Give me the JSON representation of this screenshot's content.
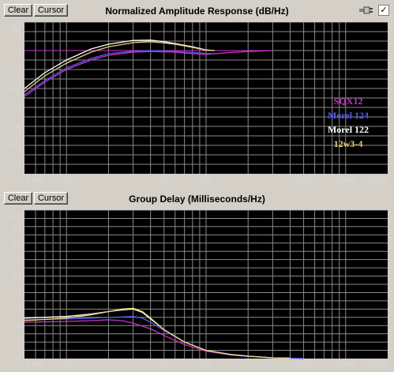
{
  "top": {
    "clear_label": "Clear",
    "cursor_label": "Cursor",
    "title": "Normalized Amplitude Response (dB/Hz)",
    "check": "✓"
  },
  "bottom": {
    "clear_label": "Clear",
    "cursor_label": "Cursor",
    "title": "Group Delay (Milliseconds/Hz)"
  },
  "colors": {
    "plot_bg": "#000000",
    "grid": "#8a8a8a",
    "tick_text": "#d8d8d8",
    "zero_line": "#cc33cc"
  },
  "chart_data": [
    {
      "type": "line",
      "title": "Normalized Amplitude Response (dB/Hz)",
      "x_scale": "log",
      "xlim": [
        5,
        2000
      ],
      "ylim": [
        -39,
        9
      ],
      "y_unit_label": "dB",
      "x_ticks": [
        5,
        10,
        50,
        100,
        500,
        1000,
        2000
      ],
      "x_tick_labels": [
        "5 Hz",
        "10",
        "50",
        "100",
        "500",
        "1000",
        "2000"
      ],
      "y_ticks": [
        6,
        0,
        -6,
        -12,
        -18,
        -24,
        -30,
        -36
      ],
      "y_tick_labels": [
        "6",
        "0",
        "-6",
        "-12",
        "-18",
        "-24",
        "-30",
        "-36"
      ],
      "grid": true,
      "legend_placement": "right",
      "series": [
        {
          "name": "SQX12",
          "color": "#cc33cc",
          "x": [
            5,
            7,
            10,
            15,
            20,
            30,
            40,
            60,
            80,
            100,
            150,
            200,
            300
          ],
          "y": [
            -14.5,
            -10,
            -6,
            -3,
            -1.5,
            -0.5,
            -0.3,
            -0.5,
            -1.0,
            -1.2,
            -0.6,
            -0.3,
            0
          ]
        },
        {
          "name": "Morel 124",
          "color": "#5555ee",
          "x": [
            5,
            7,
            10,
            15,
            20,
            30,
            40,
            60,
            80,
            100,
            115
          ],
          "y": [
            -14,
            -9.5,
            -5.5,
            -2.5,
            -1.0,
            -0.2,
            0,
            -0.3,
            -0.6,
            -0.9,
            -1.0
          ]
        },
        {
          "name": "Morel 122",
          "color": "#ffffff",
          "x": [
            5,
            7,
            10,
            15,
            20,
            30,
            40,
            50,
            60,
            80,
            100,
            115
          ],
          "y": [
            -12,
            -7,
            -3,
            0.5,
            2.0,
            3.2,
            3.3,
            2.8,
            2.2,
            1.2,
            0.2,
            0
          ]
        },
        {
          "name": "12w3-4",
          "color": "#e8d27a",
          "x": [
            5,
            7,
            10,
            15,
            20,
            30,
            40,
            50,
            60,
            80,
            100,
            115
          ],
          "y": [
            -13,
            -8,
            -4,
            -0.5,
            1.2,
            2.5,
            2.8,
            2.4,
            2.0,
            1.0,
            0.1,
            0
          ]
        }
      ]
    },
    {
      "type": "line",
      "title": "Group Delay (Milliseconds/Hz)",
      "x_scale": "log",
      "xlim": [
        5,
        2000
      ],
      "ylim": [
        0,
        18
      ],
      "y_unit_label": "ms",
      "x_ticks": [
        5,
        10,
        50,
        100,
        500,
        1000,
        2000
      ],
      "x_tick_labels": [
        "5 Hz",
        "10",
        "50",
        "100",
        "500",
        "1000",
        "2000"
      ],
      "y_ticks": [
        16,
        14,
        12,
        10,
        8,
        6,
        4,
        2,
        0
      ],
      "y_tick_labels": [
        "16",
        "14",
        "12",
        "10",
        "8",
        "6",
        "4",
        "2",
        "0"
      ],
      "grid": true,
      "series": [
        {
          "name": "SQX12",
          "color": "#cc33cc",
          "x": [
            5,
            10,
            15,
            20,
            25,
            30,
            40,
            50,
            70,
            100,
            150,
            200,
            300,
            500
          ],
          "y": [
            4.4,
            4.5,
            4.6,
            4.7,
            4.6,
            4.3,
            3.6,
            2.8,
            1.7,
            0.9,
            0.45,
            0.25,
            0.1,
            0.02
          ]
        },
        {
          "name": "Morel 124",
          "color": "#5555ee",
          "x": [
            5,
            10,
            15,
            20,
            25,
            30,
            35,
            40,
            50,
            70,
            100,
            150,
            200,
            300,
            500
          ],
          "y": [
            4.7,
            4.8,
            4.9,
            5.0,
            5.05,
            5.1,
            4.9,
            4.4,
            3.4,
            2.0,
            1.0,
            0.45,
            0.25,
            0.1,
            0.02
          ]
        },
        {
          "name": "Morel 122",
          "color": "#ffffff",
          "x": [
            5,
            10,
            15,
            20,
            25,
            30,
            35,
            40,
            50,
            70,
            100,
            150,
            200,
            300,
            400
          ],
          "y": [
            4.9,
            5.1,
            5.4,
            5.7,
            5.9,
            6.0,
            5.6,
            4.8,
            3.5,
            2.0,
            1.0,
            0.5,
            0.3,
            0.1,
            0.05
          ]
        },
        {
          "name": "12w3-4",
          "color": "#e8d27a",
          "x": [
            5,
            10,
            15,
            20,
            25,
            30,
            35,
            40,
            50,
            70,
            100,
            150,
            200,
            300,
            400
          ],
          "y": [
            4.6,
            4.9,
            5.3,
            5.7,
            6.0,
            6.1,
            5.7,
            4.9,
            3.5,
            2.0,
            1.0,
            0.5,
            0.3,
            0.1,
            0.05
          ]
        }
      ]
    }
  ]
}
